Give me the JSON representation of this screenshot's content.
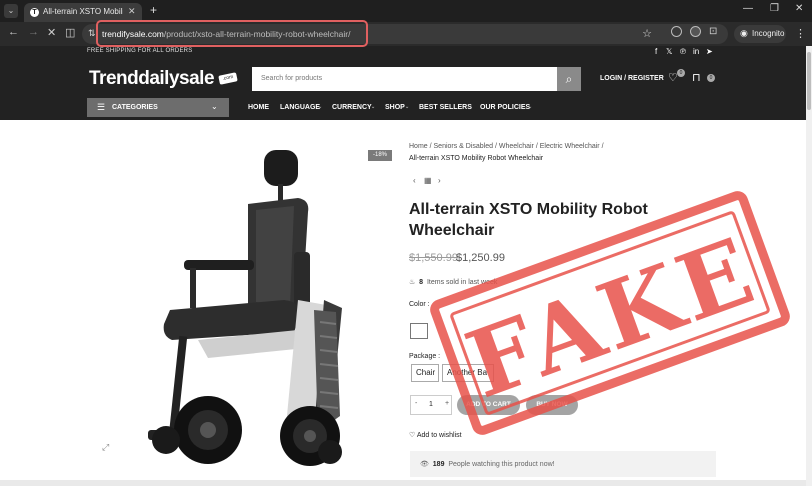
{
  "browser": {
    "tab_title": "All-terrain XSTO Mobility Ro",
    "tab_favicon": "T",
    "url_host": "trendifysale.com",
    "url_path": "/product/xsto-all-terrain-mobility-robot-wheelchair/",
    "incognito_label": "Incognito"
  },
  "site": {
    "promo": "FREE SHIPPING FOR ALL ORDERS",
    "logo": "Trenddailysale",
    "logo_tag": ".com",
    "search_placeholder": "Search for products",
    "login_label": "LOGIN / REGISTER",
    "wishlist_count": "0",
    "cart_count": "0",
    "categories_label": "CATEGORIES",
    "menu": [
      "HOME",
      "LANGUAGE",
      "CURRENCY",
      "SHOP",
      "BEST SELLERS",
      "OUR POLICIES"
    ]
  },
  "product": {
    "sale_badge": "-18%",
    "breadcrumb": "Home  /  Seniors & Disabled  /  Wheelchair  /  Electric Wheelchair  /",
    "breadcrumb_current": "All-terrain XSTO Mobility Robot Wheelchair",
    "title": "All-terrain XSTO Mobility Robot Wheelchair",
    "price_old": "$1,550.99",
    "price_new": "$1,250.99",
    "sold_count": "8",
    "sold_text": "Items sold in last week",
    "color_label": "Color :",
    "package_label": "Package :",
    "packages": [
      "Chair",
      "Another Ba"
    ],
    "quantity": "1",
    "add_to_cart": "ADD TO CART",
    "buy_now": "BUY NOW",
    "wishlist": "Add to wishlist",
    "watching_count": "189",
    "watching_text": "People watching this product now!"
  },
  "overlay": {
    "stamp_text": "FAKE",
    "stamp_color": "#e8524a",
    "highlight_color": "#e06060"
  }
}
